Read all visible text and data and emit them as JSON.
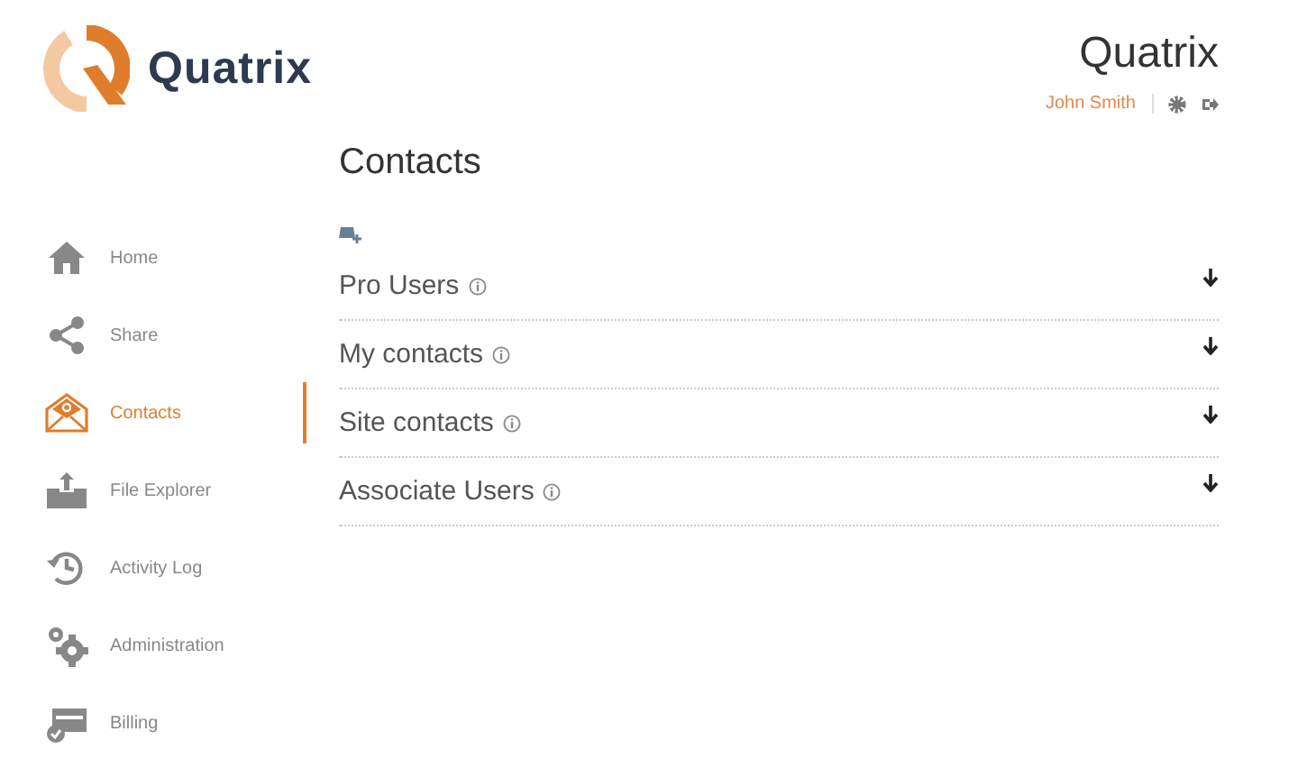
{
  "logo": {
    "text": "Quatrix"
  },
  "header": {
    "title": "Quatrix",
    "user": "John Smith"
  },
  "sidebar": {
    "items": [
      {
        "label": "Home",
        "kind": "home",
        "selected": false
      },
      {
        "label": "Share",
        "kind": "share",
        "selected": false
      },
      {
        "label": "Contacts",
        "kind": "contacts",
        "selected": true
      },
      {
        "label": "File Explorer",
        "kind": "upload",
        "selected": false
      },
      {
        "label": "Activity Log",
        "kind": "history",
        "selected": false
      },
      {
        "label": "Administration",
        "kind": "gears",
        "selected": false
      },
      {
        "label": "Billing",
        "kind": "billing",
        "selected": false
      }
    ]
  },
  "page": {
    "title": "Contacts",
    "groups": [
      {
        "label": "Pro Users"
      },
      {
        "label": "My contacts"
      },
      {
        "label": "Site contacts"
      },
      {
        "label": "Associate Users"
      }
    ]
  }
}
